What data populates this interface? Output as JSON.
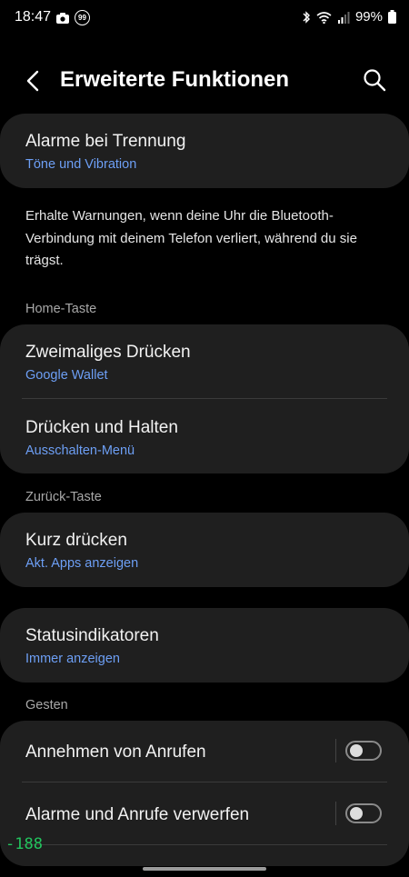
{
  "status_bar": {
    "time": "18:47",
    "notification_badge": "99",
    "battery": "99%"
  },
  "header": {
    "title": "Erweiterte Funktionen"
  },
  "separation_alarm": {
    "title": "Alarme bei Trennung",
    "subtitle": "Töne und Vibration",
    "description": "Erhalte Warnungen, wenn deine Uhr die Bluetooth-Verbindung mit deinem Telefon verliert, während du sie trägst."
  },
  "home_key": {
    "section_label": "Home-Taste",
    "items": [
      {
        "title": "Zweimaliges Drücken",
        "subtitle": "Google Wallet"
      },
      {
        "title": "Drücken und Halten",
        "subtitle": "Ausschalten-Menü"
      }
    ]
  },
  "back_key": {
    "section_label": "Zurück-Taste",
    "items": [
      {
        "title": "Kurz drücken",
        "subtitle": "Akt. Apps anzeigen"
      }
    ]
  },
  "status_indicators": {
    "title": "Statusindikatoren",
    "subtitle": "Immer anzeigen"
  },
  "gestures": {
    "section_label": "Gesten",
    "items": [
      {
        "title": "Annehmen von Anrufen",
        "enabled": false
      },
      {
        "title": "Alarme und Anrufe verwerfen",
        "enabled": false
      }
    ]
  },
  "debug_overlay": "-188",
  "colors": {
    "background": "#000000",
    "card": "#1f1f1f",
    "accent_link": "#6d9ff5",
    "overlay_text": "#22c55e"
  }
}
